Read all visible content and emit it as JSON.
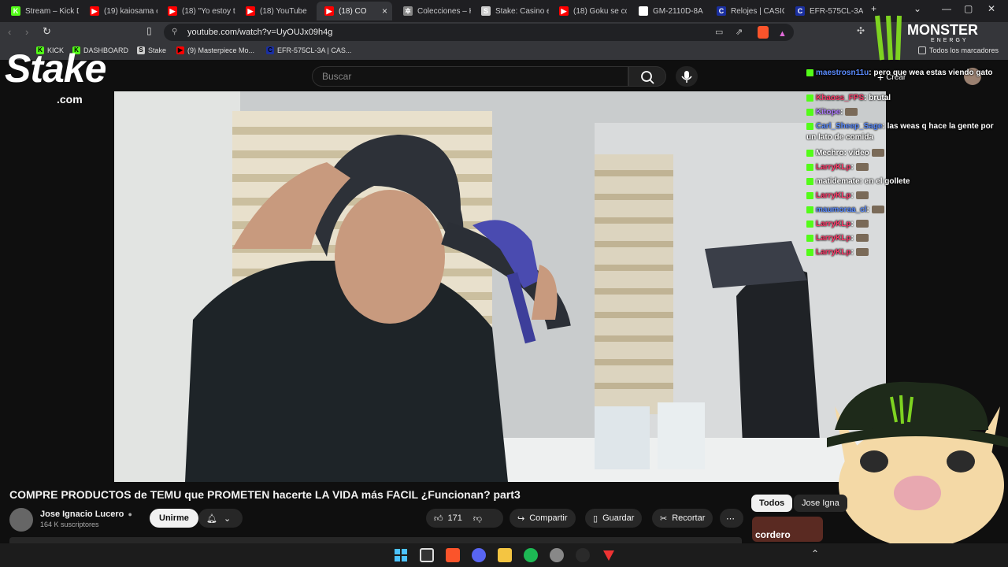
{
  "browser": {
    "tabs": [
      {
        "label": "Stream – Kick D",
        "color": "#53fc18",
        "glyph": "K"
      },
      {
        "label": "(19) kaiosama e",
        "color": "#ff0000",
        "glyph": "▶"
      },
      {
        "label": "(18) \"Yo estoy t",
        "color": "#ff0000",
        "glyph": "▶"
      },
      {
        "label": "(18) YouTube",
        "color": "#ff0000",
        "glyph": "▶"
      },
      {
        "label": "(18) CO",
        "color": "#ff0000",
        "glyph": "▶"
      },
      {
        "label": "Colecciones – K",
        "color": "#888888",
        "glyph": "✲"
      },
      {
        "label": "Stake: Casino e",
        "color": "#cccccc",
        "glyph": "S"
      },
      {
        "label": "(18) Goku se co",
        "color": "#ff0000",
        "glyph": "▶"
      },
      {
        "label": "GM-2110D-8A",
        "color": "#ffffff",
        "glyph": "G"
      },
      {
        "label": "Relojes | CASIO",
        "color": "#1a2fa0",
        "glyph": "C"
      },
      {
        "label": "EFR-575CL-3A",
        "color": "#1a2fa0",
        "glyph": "C"
      }
    ],
    "url": "youtube.com/watch?v=UyOUJx09h4g",
    "bookmarks": [
      {
        "label": "KICK",
        "color": "#53fc18",
        "glyph": "K"
      },
      {
        "label": "DASHBOARD",
        "color": "#53fc18",
        "glyph": "K"
      },
      {
        "label": "Stake",
        "color": "#cccccc",
        "glyph": "S"
      },
      {
        "label": "(9) Masterpiece Mo...",
        "color": "#ff0000",
        "glyph": "▶"
      },
      {
        "label": "EFR-575CL-3A | CAS...",
        "color": "#1a2fa0",
        "glyph": "C"
      }
    ],
    "all_bookmarks": "Todos los marcadores"
  },
  "overlay": {
    "stake_logo": "Stake",
    "stake_sub": ".com",
    "monster_logo": "MONSTER",
    "monster_sub": "ENERGY"
  },
  "youtube": {
    "search_placeholder": "Buscar",
    "create_label": "Crear",
    "video_title": "COMPRE PRODUCTOS de TEMU que PROMETEN hacerte LA VIDA más FACIL ¿Funcionan? part3",
    "channel_name": "Jose Ignacio Lucero",
    "subscribers": "164 K suscriptores",
    "join_label": "Unirme",
    "likes": "171",
    "share_label": "Compartir",
    "save_label": "Guardar",
    "clip_label": "Recortar",
    "chips": [
      "Todos",
      "Jose Igna"
    ],
    "thumb_text": "cordero"
  },
  "chat": [
    {
      "user": "maestrosn11u",
      "color": "#5b8cff",
      "text": ": pero que wea estas viendo gato"
    },
    {
      "user": "Khaoss_FPS",
      "color": "#ff3b6b",
      "text": ": brutal"
    },
    {
      "user": "Kitope",
      "color": "#b07bff",
      "text": ":"
    },
    {
      "user": "Carl_Sheep_Sage",
      "color": "#5b8cff",
      "text": ": las weas q hace la gente por un lato de comida"
    },
    {
      "user": "Mechro",
      "color": "#ffffff",
      "text": ": video"
    },
    {
      "user": "LarryKLp",
      "color": "#ff3b6b",
      "text": ":"
    },
    {
      "user": "matidemate",
      "color": "#ffffff",
      "text": ": en el gollete"
    },
    {
      "user": "LarryKLp",
      "color": "#ff3b6b",
      "text": ":"
    },
    {
      "user": "maumoraa_cl",
      "color": "#5b8cff",
      "text": ":"
    },
    {
      "user": "LarryKLp",
      "color": "#ff3b6b",
      "text": ":"
    },
    {
      "user": "LarryKLp",
      "color": "#ff3b6b",
      "text": ":"
    },
    {
      "user": "LarryKLp",
      "color": "#ff3b6b",
      "text": ":"
    }
  ]
}
